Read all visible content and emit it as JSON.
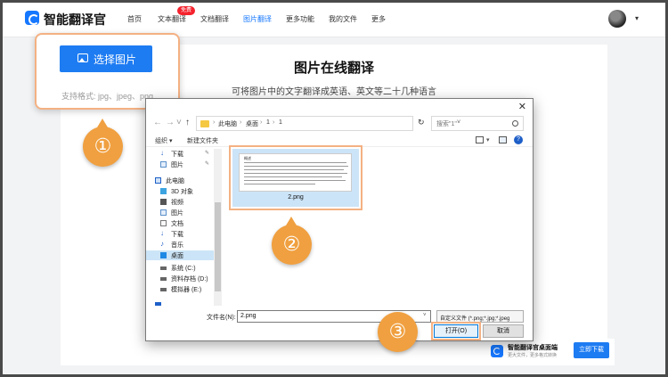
{
  "app": {
    "name": "智能翻译官"
  },
  "nav": {
    "items": [
      "首页",
      "文本翻译",
      "文档翻译",
      "图片翻译",
      "更多功能",
      "我的文件",
      "更多"
    ],
    "free_badge": "免费",
    "active_index": 3
  },
  "page": {
    "title": "图片在线翻译",
    "subtitle": "可将图片中的文字翻译成英语、英文等二十几种语言"
  },
  "upload": {
    "button_label": "选择图片",
    "formats": "支持格式: jpg、jpeg、png"
  },
  "markers": [
    "①",
    "②",
    "③"
  ],
  "dialog": {
    "path": [
      "此电脑",
      "桌面",
      "1",
      "1"
    ],
    "search_placeholder": "搜索\"1\"",
    "toolbar": {
      "organize": "组织 ▾",
      "new_folder": "新建文件夹"
    },
    "tree": [
      {
        "label": "下载",
        "icon": "download-arrow-icon",
        "pinned": true
      },
      {
        "label": "图片",
        "icon": "pictures-icon",
        "pinned": true
      },
      {
        "label": "此电脑",
        "icon": "computer-icon"
      },
      {
        "label": "3D 对象",
        "icon": "3d-objects-icon"
      },
      {
        "label": "视频",
        "icon": "videos-icon"
      },
      {
        "label": "图片",
        "icon": "pictures-icon"
      },
      {
        "label": "文档",
        "icon": "documents-icon"
      },
      {
        "label": "下载",
        "icon": "download-arrow-icon"
      },
      {
        "label": "音乐",
        "icon": "music-icon"
      },
      {
        "label": "桌面",
        "icon": "desktop-icon",
        "selected": true
      },
      {
        "label": "系统 (C:)",
        "icon": "drive-icon"
      },
      {
        "label": "资料存档 (D:)",
        "icon": "drive-icon"
      },
      {
        "label": "模拟器 (E:)",
        "icon": "drive-icon"
      }
    ],
    "file": {
      "name": "2.png",
      "thumb_title": "概述"
    },
    "filename_label": "文件名(N):",
    "filename_value": "2.png",
    "file_type": "自定义文件 (*.png;*.jpg;*.jpeg",
    "open_label": "打开(O)",
    "cancel_label": "取消",
    "close_glyph": "✕"
  },
  "promo": {
    "title": "智能翻译官桌面端",
    "subtitle": "更大文件，更多格式转换",
    "button_label": "立即下载"
  },
  "colors": {
    "brand": "#1677ff",
    "button": "#1e7cf2",
    "highlight": "#f4b183",
    "marker": "#f0a040",
    "badge": "#f5222d"
  }
}
